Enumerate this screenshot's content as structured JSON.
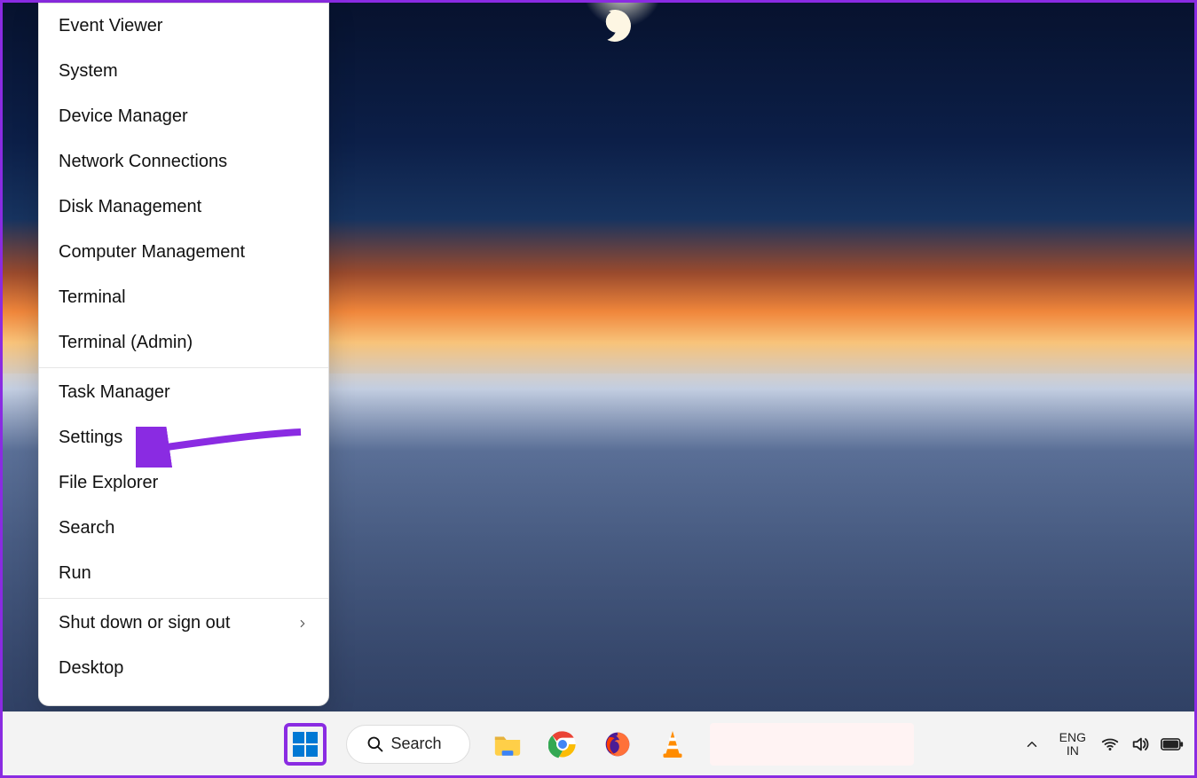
{
  "context_menu": {
    "groups": [
      {
        "items": [
          {
            "label": "Event Viewer"
          },
          {
            "label": "System"
          },
          {
            "label": "Device Manager"
          },
          {
            "label": "Network Connections"
          },
          {
            "label": "Disk Management"
          },
          {
            "label": "Computer Management"
          },
          {
            "label": "Terminal"
          },
          {
            "label": "Terminal (Admin)"
          }
        ]
      },
      {
        "items": [
          {
            "label": "Task Manager"
          },
          {
            "label": "Settings",
            "highlighted": true
          },
          {
            "label": "File Explorer"
          },
          {
            "label": "Search"
          },
          {
            "label": "Run"
          }
        ]
      },
      {
        "items": [
          {
            "label": "Shut down or sign out",
            "submenu": true
          },
          {
            "label": "Desktop"
          }
        ]
      }
    ]
  },
  "taskbar": {
    "search_label": "Search"
  },
  "tray": {
    "lang_line1": "ENG",
    "lang_line2": "IN"
  },
  "annotation": {
    "accent_color": "#8a2be2"
  }
}
